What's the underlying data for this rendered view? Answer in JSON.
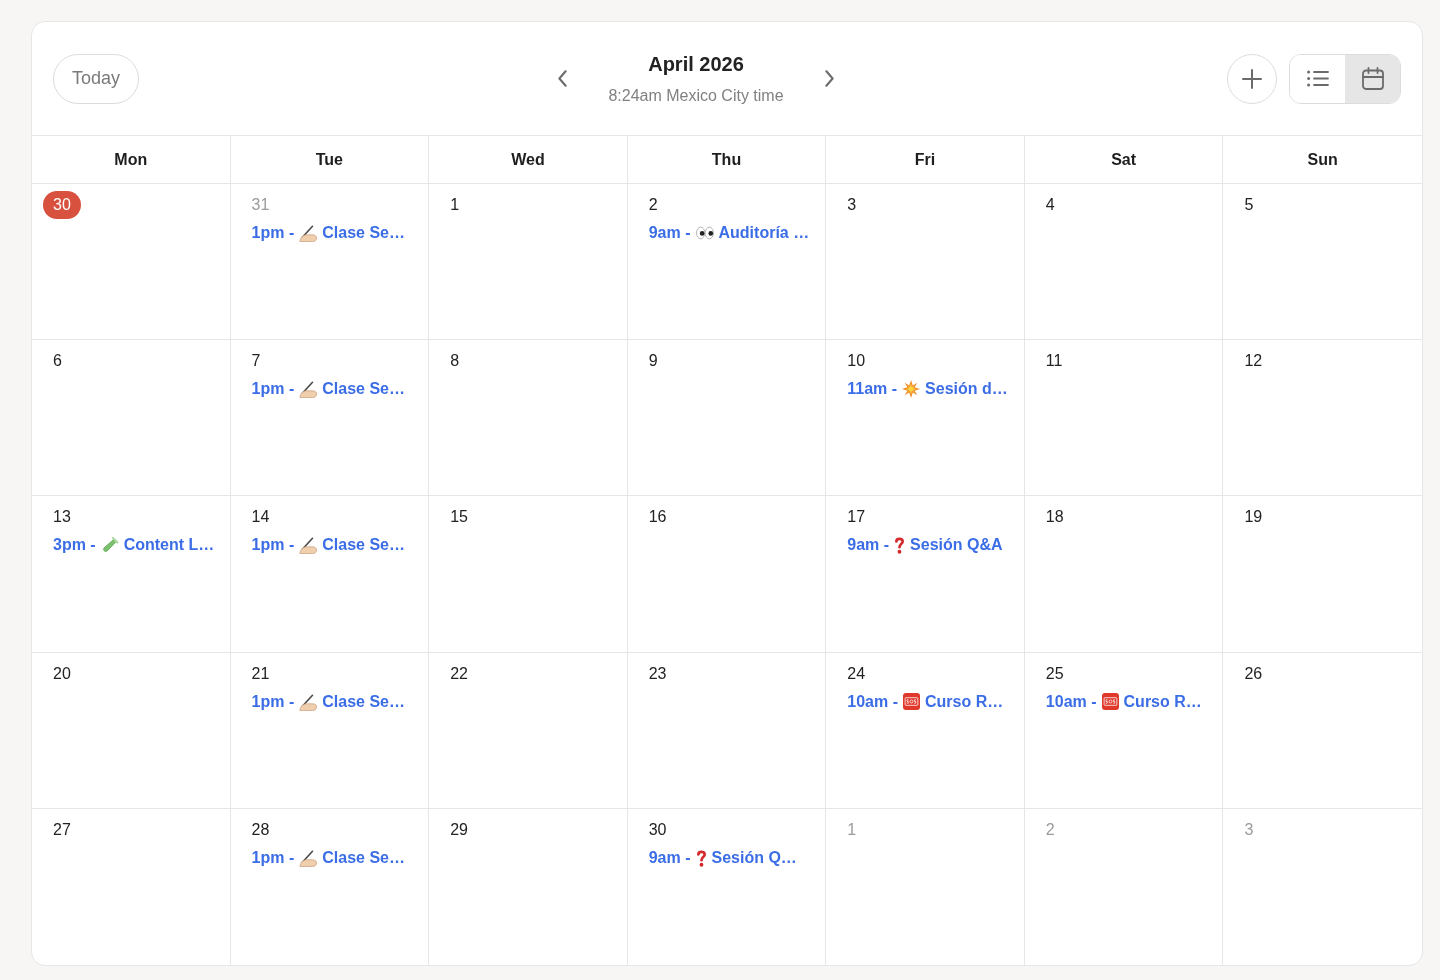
{
  "header": {
    "today_button": "Today",
    "title": "April 2026",
    "subtitle": "8:24am Mexico City time",
    "views": [
      {
        "kind": "list",
        "selected": false
      },
      {
        "kind": "calendar",
        "selected": true
      }
    ]
  },
  "weekdays": [
    "Mon",
    "Tue",
    "Wed",
    "Thu",
    "Fri",
    "Sat",
    "Sun"
  ],
  "weeks": [
    {
      "days": [
        {
          "day": "30",
          "today": true,
          "dimmed": false
        },
        {
          "day": "31",
          "today": false,
          "dimmed": true,
          "events": [
            {
              "kind": "writing-hand",
              "time": "1pm -",
              "title": "Clase Se…"
            }
          ]
        },
        {
          "day": "1",
          "today": false,
          "dimmed": false
        },
        {
          "day": "2",
          "today": false,
          "dimmed": false,
          "events": [
            {
              "kind": "eyes",
              "time": "9am -",
              "title": "Auditoría …"
            }
          ]
        },
        {
          "day": "3",
          "today": false,
          "dimmed": false
        },
        {
          "day": "4",
          "today": false,
          "dimmed": false
        },
        {
          "day": "5",
          "today": false,
          "dimmed": false
        }
      ]
    },
    {
      "days": [
        {
          "day": "6",
          "today": false,
          "dimmed": false
        },
        {
          "day": "7",
          "today": false,
          "dimmed": false,
          "events": [
            {
              "kind": "writing-hand",
              "time": "1pm -",
              "title": "Clase Se…"
            }
          ]
        },
        {
          "day": "8",
          "today": false,
          "dimmed": false
        },
        {
          "day": "9",
          "today": false,
          "dimmed": false
        },
        {
          "day": "10",
          "today": false,
          "dimmed": false,
          "events": [
            {
              "kind": "burst",
              "time": "11am -",
              "title": "Sesión d…"
            }
          ]
        },
        {
          "day": "11",
          "today": false,
          "dimmed": false
        },
        {
          "day": "12",
          "today": false,
          "dimmed": false
        }
      ]
    },
    {
      "days": [
        {
          "day": "13",
          "today": false,
          "dimmed": false,
          "events": [
            {
              "kind": "test-tube",
              "time": "3pm -",
              "title": "Content L…"
            }
          ]
        },
        {
          "day": "14",
          "today": false,
          "dimmed": false,
          "events": [
            {
              "kind": "writing-hand",
              "time": "1pm -",
              "title": "Clase Se…"
            }
          ]
        },
        {
          "day": "15",
          "today": false,
          "dimmed": false
        },
        {
          "day": "16",
          "today": false,
          "dimmed": false
        },
        {
          "day": "17",
          "today": false,
          "dimmed": false,
          "events": [
            {
              "kind": "question",
              "time": "9am -",
              "title": "Sesión Q&A"
            }
          ]
        },
        {
          "day": "18",
          "today": false,
          "dimmed": false
        },
        {
          "day": "19",
          "today": false,
          "dimmed": false
        }
      ]
    },
    {
      "days": [
        {
          "day": "20",
          "today": false,
          "dimmed": false
        },
        {
          "day": "21",
          "today": false,
          "dimmed": false,
          "events": [
            {
              "kind": "writing-hand",
              "time": "1pm -",
              "title": "Clase Se…"
            }
          ]
        },
        {
          "day": "22",
          "today": false,
          "dimmed": false
        },
        {
          "day": "23",
          "today": false,
          "dimmed": false
        },
        {
          "day": "24",
          "today": false,
          "dimmed": false,
          "events": [
            {
              "kind": "sos",
              "time": "10am -",
              "title": "Curso R…"
            }
          ]
        },
        {
          "day": "25",
          "today": false,
          "dimmed": false,
          "events": [
            {
              "kind": "sos",
              "time": "10am -",
              "title": "Curso R…"
            }
          ]
        },
        {
          "day": "26",
          "today": false,
          "dimmed": false
        }
      ]
    },
    {
      "days": [
        {
          "day": "27",
          "today": false,
          "dimmed": false
        },
        {
          "day": "28",
          "today": false,
          "dimmed": false,
          "events": [
            {
              "kind": "writing-hand",
              "time": "1pm -",
              "title": "Clase Se…"
            }
          ]
        },
        {
          "day": "29",
          "today": false,
          "dimmed": false
        },
        {
          "day": "30",
          "today": false,
          "dimmed": false,
          "events": [
            {
              "kind": "question",
              "time": "9am -",
              "title": "Sesión Q…"
            }
          ]
        },
        {
          "day": "1",
          "today": false,
          "dimmed": true
        },
        {
          "day": "2",
          "today": false,
          "dimmed": true
        },
        {
          "day": "3",
          "today": false,
          "dimmed": true
        }
      ]
    }
  ]
}
